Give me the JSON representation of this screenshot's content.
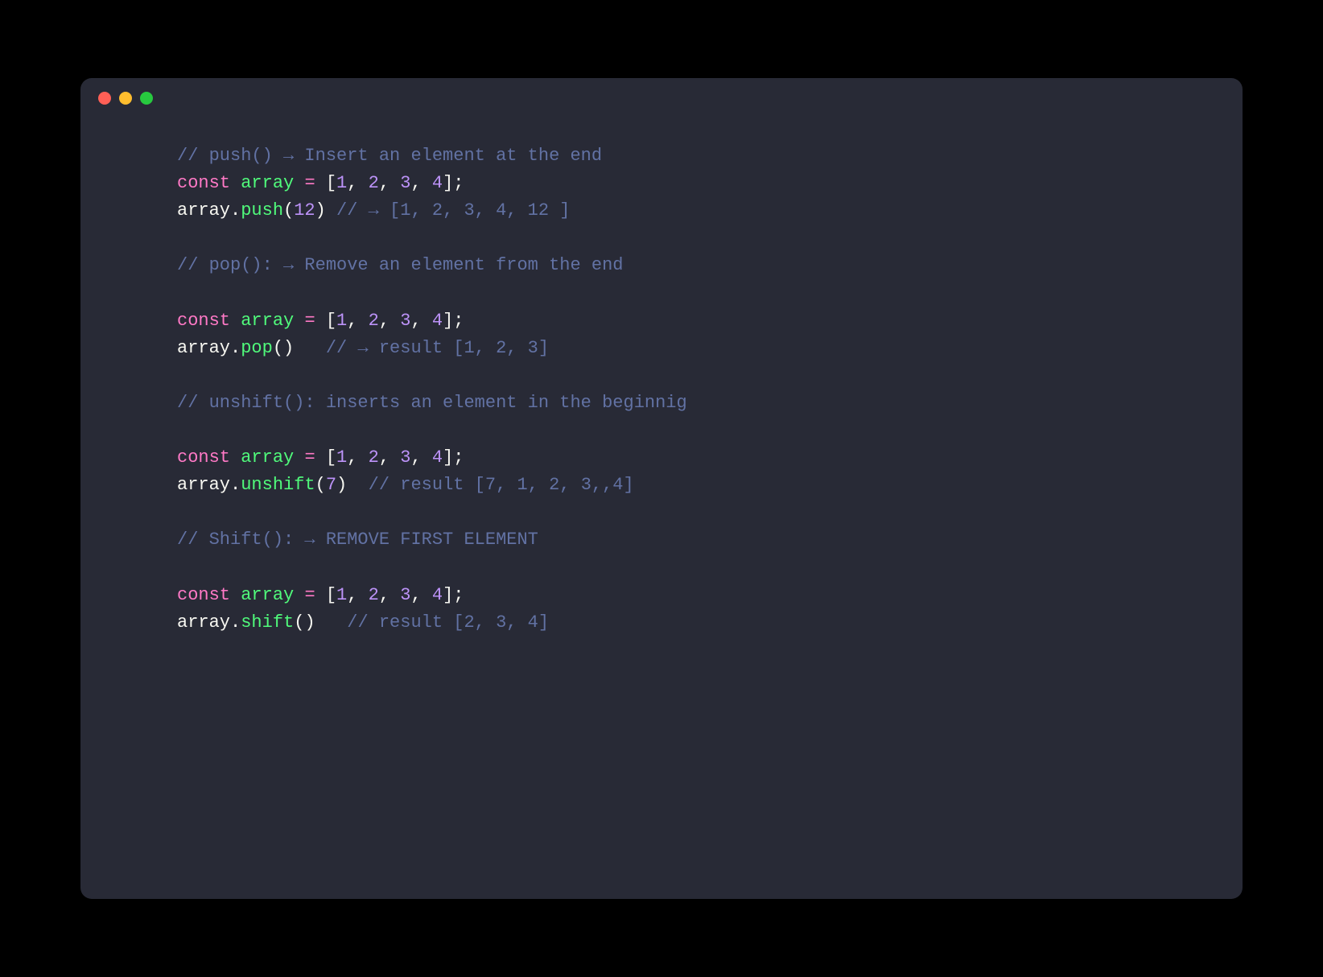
{
  "window": {
    "traffic_lights": [
      "close",
      "minimize",
      "zoom"
    ]
  },
  "code": {
    "lines": [
      {
        "type": "comment",
        "text": "// push() → Insert an element at the end"
      },
      {
        "type": "decl",
        "kw": "const",
        "name": "array",
        "eq": " = ",
        "arr_open": "[",
        "nums": [
          "1",
          "2",
          "3",
          "4"
        ],
        "arr_close": "];"
      },
      {
        "type": "call",
        "obj": "array",
        "dot": ".",
        "method": "push",
        "paren_open": "(",
        "args": [
          "12"
        ],
        "paren_close": ")",
        "trail": " ",
        "comment": "// → [1, 2, 3, 4, 12 ]"
      },
      {
        "type": "blank"
      },
      {
        "type": "comment",
        "text": "// pop(): → Remove an element from the end"
      },
      {
        "type": "blank"
      },
      {
        "type": "decl",
        "kw": "const",
        "name": "array",
        "eq": " = ",
        "arr_open": "[",
        "nums": [
          "1",
          "2",
          "3",
          "4"
        ],
        "arr_close": "];"
      },
      {
        "type": "call",
        "obj": "array",
        "dot": ".",
        "method": "pop",
        "paren_open": "(",
        "args": [],
        "paren_close": ")",
        "trail": "   ",
        "comment": "// → result [1, 2, 3]"
      },
      {
        "type": "blank"
      },
      {
        "type": "comment",
        "text": "// unshift(): inserts an element in the beginnig"
      },
      {
        "type": "blank"
      },
      {
        "type": "decl",
        "kw": "const",
        "name": "array",
        "eq": " = ",
        "arr_open": "[",
        "nums": [
          "1",
          "2",
          "3",
          "4"
        ],
        "arr_close": "];"
      },
      {
        "type": "call",
        "obj": "array",
        "dot": ".",
        "method": "unshift",
        "paren_open": "(",
        "args": [
          "7"
        ],
        "paren_close": ")",
        "trail": "  ",
        "comment": "// result [7, 1, 2, 3,,4]"
      },
      {
        "type": "blank"
      },
      {
        "type": "comment",
        "text": "// Shift(): → REMOVE FIRST ELEMENT"
      },
      {
        "type": "blank"
      },
      {
        "type": "decl",
        "kw": "const",
        "name": "array",
        "eq": " = ",
        "arr_open": "[",
        "nums": [
          "1",
          "2",
          "3",
          "4"
        ],
        "arr_close": "];"
      },
      {
        "type": "call",
        "obj": "array",
        "dot": ".",
        "method": "shift",
        "paren_open": "(",
        "args": [],
        "paren_close": ")",
        "trail": "   ",
        "comment": "// result [2, 3, 4]"
      }
    ]
  }
}
